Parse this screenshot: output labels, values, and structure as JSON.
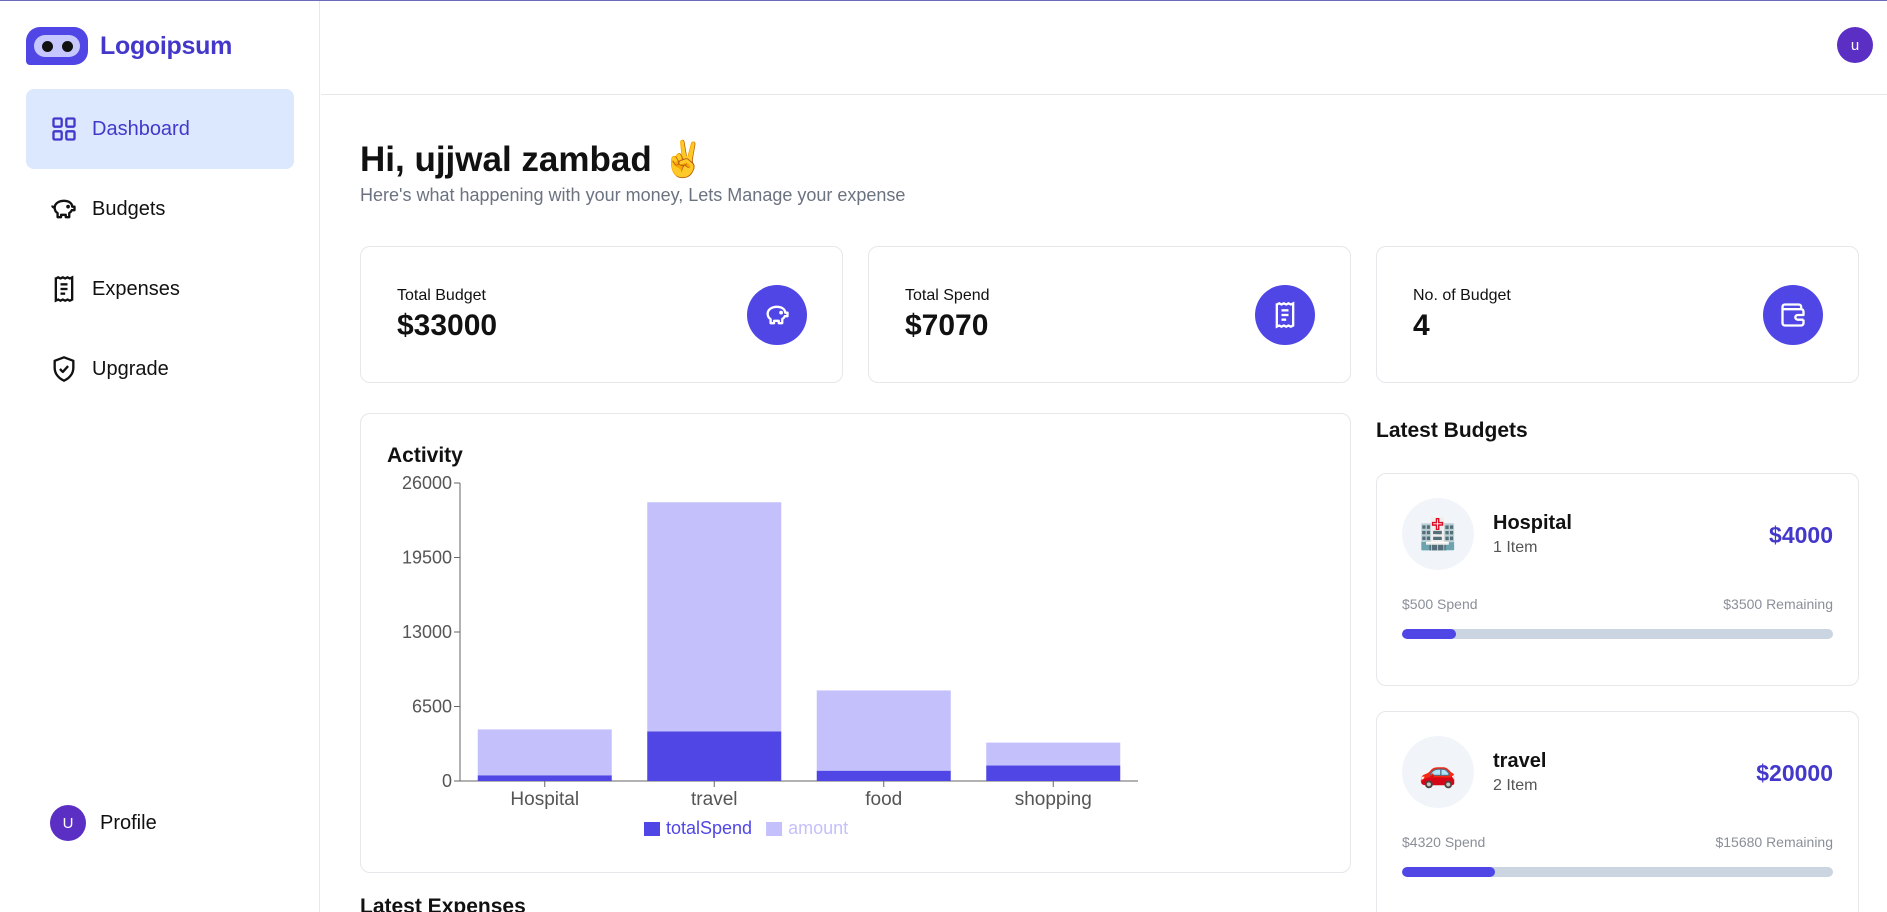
{
  "brand": {
    "name": "Logoipsum"
  },
  "sidebar": {
    "items": [
      {
        "label": "Dashboard",
        "icon": "dashboard-grid-icon",
        "active": true
      },
      {
        "label": "Budgets",
        "icon": "piggy-bank-icon",
        "active": false
      },
      {
        "label": "Expenses",
        "icon": "receipt-icon",
        "active": false
      },
      {
        "label": "Upgrade",
        "icon": "shield-check-icon",
        "active": false
      }
    ],
    "profile": {
      "label": "Profile",
      "avatar_letter": "U"
    }
  },
  "header": {
    "avatar_letter": "u"
  },
  "greeting": {
    "title": "Hi, ujjwal zambad ✌️",
    "subtitle": "Here's what happening with your money, Lets Manage your expense"
  },
  "stats": [
    {
      "label": "Total Budget",
      "value": "$33000",
      "icon": "piggy-bank-icon"
    },
    {
      "label": "Total Spend",
      "value": "$7070",
      "icon": "receipt-icon"
    },
    {
      "label": "No. of Budget",
      "value": "4",
      "icon": "wallet-icon"
    }
  ],
  "activity": {
    "title": "Activity"
  },
  "chart_data": {
    "type": "bar",
    "stacked": true,
    "categories": [
      "Hospital",
      "travel",
      "food",
      "shopping"
    ],
    "series": [
      {
        "name": "totalSpend",
        "values": [
          500,
          4320,
          900,
          1350
        ],
        "color": "#4f46e5"
      },
      {
        "name": "amount",
        "values": [
          4000,
          20000,
          7000,
          2000
        ],
        "color": "#c3c0fc"
      }
    ],
    "yticks": [
      0,
      6500,
      13000,
      19500,
      26000
    ],
    "ylim": [
      0,
      26000
    ],
    "legend_position": "bottom",
    "grid": false
  },
  "latest_budgets": {
    "title": "Latest Budgets",
    "items": [
      {
        "emoji": "🏥",
        "name": "Hospital",
        "items": "1 Item",
        "amount": "$4000",
        "spend": "$500 Spend",
        "remaining": "$3500 Remaining",
        "progress": 0.125
      },
      {
        "emoji": "🚗",
        "name": "travel",
        "items": "2 Item",
        "amount": "$20000",
        "spend": "$4320 Spend",
        "remaining": "$15680 Remaining",
        "progress": 0.216
      }
    ]
  },
  "latest_expenses": {
    "title": "Latest Expenses"
  },
  "colors": {
    "accent": "#4f46e5",
    "accent_light": "#c3c0fc",
    "active_nav_bg": "#dbe8fe",
    "avatar": "#5b2ec4"
  }
}
